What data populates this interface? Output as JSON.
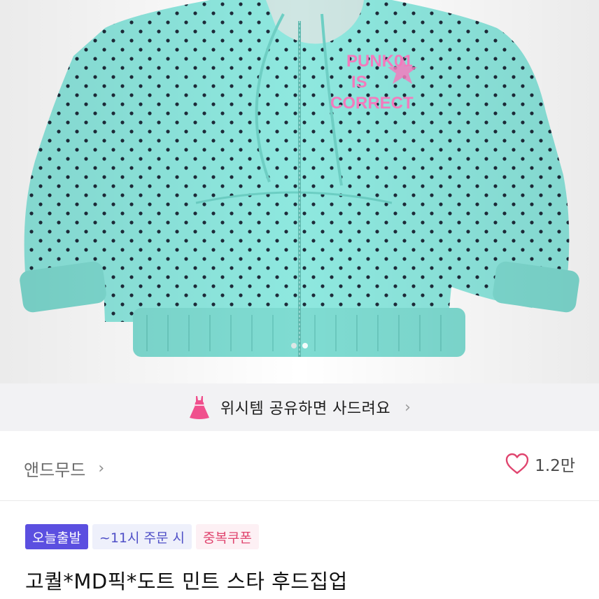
{
  "product_image": {
    "alt": "mint polka-dot zip-up hoodie",
    "print_lines": [
      "PUNK01",
      "IS",
      "CORRECT"
    ],
    "colors": {
      "hoodie": "#8ee8df",
      "dots": "#1e2b3a",
      "print": "#f27bbd"
    }
  },
  "pager": {
    "count": 2,
    "active": 0
  },
  "wish_banner": {
    "icon": "dress-icon",
    "text": "위시템 공유하면 사드려요",
    "chevron": "›"
  },
  "brand": {
    "name": "앤드무드",
    "chevron": "›"
  },
  "like": {
    "icon": "heart-icon",
    "count": "1.2만",
    "color": "#e0456f"
  },
  "badges": {
    "today_ship": "오늘출발",
    "order_time": "~11시 주문 시",
    "coupon": "중복쿠폰"
  },
  "product": {
    "title": "고퀄*MD픽*도트 민트 스타 후드집업"
  },
  "colors": {
    "accent": "#5b4fe0",
    "pink": "#e0456f",
    "banner_bg": "#f2f2f4"
  }
}
